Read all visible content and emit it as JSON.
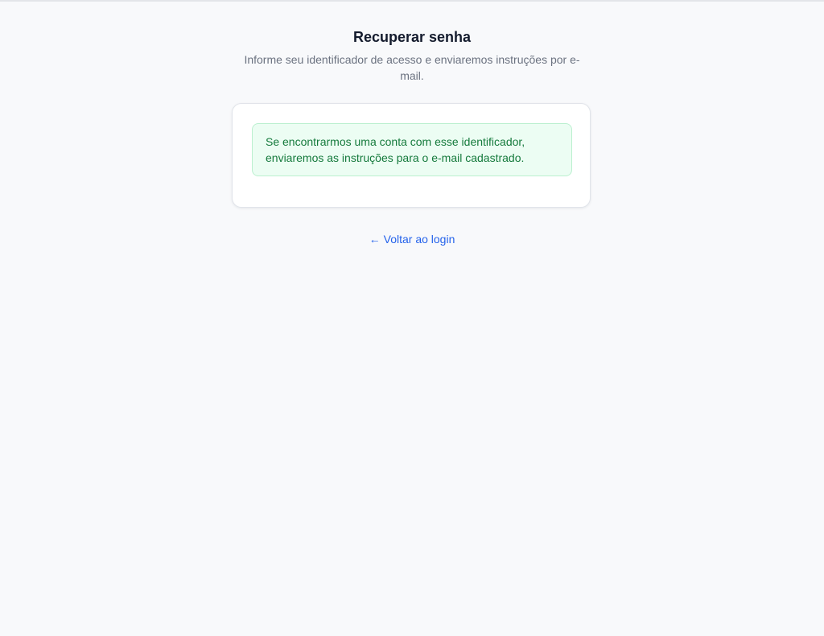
{
  "header": {
    "title": "Recuperar senha",
    "subtitle": "Informe seu identificador de acesso e enviaremos instruções por e-mail."
  },
  "card": {
    "alert": {
      "type": "success",
      "message": "Se encontrarmos uma conta com esse identificador, enviaremos as instruções para o e-mail cadastrado."
    }
  },
  "footer": {
    "back_link": {
      "arrow": "←",
      "label": "Voltar ao login"
    }
  },
  "colors": {
    "background": "#f8f9fb",
    "title": "#141b2d",
    "subtitle": "#6b7280",
    "success_bg": "#ecfdf3",
    "success_border": "#bbf0cf",
    "success_text": "#157a3c",
    "link": "#2563eb"
  }
}
